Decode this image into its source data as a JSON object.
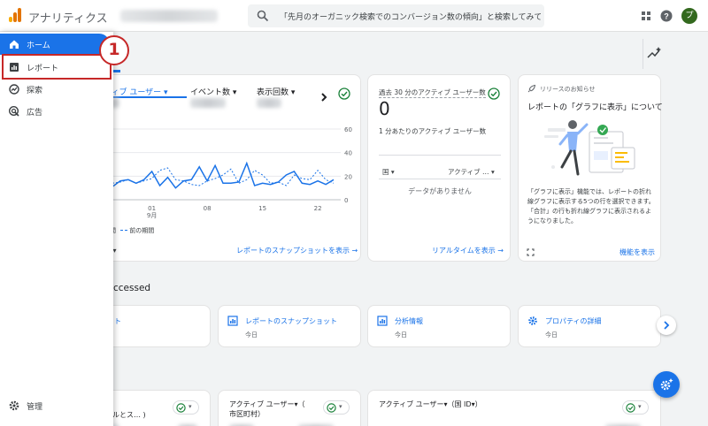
{
  "header": {
    "app_title": "アナリティクス",
    "search_placeholder": "「先月のオーガニック検索でのコンバージョン数の傾向」と検索してみてく…",
    "avatar_initial": "プ"
  },
  "sidebar": {
    "items": [
      {
        "label": "ホーム",
        "icon": "home-icon",
        "active": true
      },
      {
        "label": "レポート",
        "icon": "bar-chart-icon",
        "active": false
      },
      {
        "label": "探索",
        "icon": "explore-icon",
        "active": false
      },
      {
        "label": "広告",
        "icon": "ads-icon",
        "active": false
      }
    ],
    "admin_label": "管理"
  },
  "annotation": {
    "callout_number": "1",
    "color": "#c62828"
  },
  "overview_card": {
    "tabs": [
      {
        "label": "ティブ ユーザー ▾",
        "active": true
      },
      {
        "label": "イベント数 ▾",
        "active": false
      },
      {
        "label": "表示回数 ▾",
        "active": false
      }
    ],
    "legend_current": "日間",
    "legend_previous": "前の期間",
    "period_selector": "間 ▾",
    "link": "レポートのスナップショットを表示 →"
  },
  "chart_data": {
    "type": "line",
    "title": "",
    "y_ticks": [
      "60",
      "40",
      "20",
      "0"
    ],
    "ylim": [
      0,
      60
    ],
    "x_tick_labels": [
      "01\n9月",
      "08",
      "15",
      "22"
    ],
    "x_tick_days": [
      5,
      12,
      19,
      26
    ],
    "grid": true,
    "series": [
      {
        "name": "日間",
        "style": "solid",
        "color": "#1a73e8",
        "values": [
          11,
          16,
          17,
          14,
          17,
          24,
          12,
          19,
          10,
          16,
          17,
          28,
          16,
          29,
          14,
          14,
          15,
          31,
          12,
          14,
          13,
          15,
          21,
          24,
          14,
          13,
          16,
          13,
          17
        ]
      },
      {
        "name": "前の期間",
        "style": "dashed",
        "color": "#1a73e8",
        "values": [
          14,
          15,
          17,
          14,
          16,
          18,
          25,
          27,
          17,
          16,
          13,
          12,
          16,
          18,
          21,
          26,
          14,
          17,
          25,
          21,
          14,
          15,
          12,
          21,
          18,
          17,
          25,
          17,
          14
        ]
      }
    ]
  },
  "realtime_card": {
    "title": "過去 30 分のアクティブ ユーザー数",
    "value": "0",
    "subtitle": "1 分あたりのアクティブ ユーザー数",
    "col_country": "国 ▾",
    "col_active": "アクティブ … ▾",
    "empty": "データがありません",
    "link": "リアルタイムを表示 →"
  },
  "release_card": {
    "header": "リリースのお知らせ",
    "title": "レポートの「グラフに表示」について",
    "body": "「グラフに表示」機能では、レポートの折れ線グラフに表示する5つの行を選択できます。「合計」の行も折れ線グラフに表示されるようになりました。",
    "link": "機能を表示"
  },
  "recent": {
    "section_title": "ccessed",
    "cards": [
      {
        "label": "ト",
        "date": "",
        "icon": ""
      },
      {
        "label": "レポートのスナップショット",
        "date": "今日",
        "icon": "bar-chart-icon"
      },
      {
        "label": "分析情報",
        "date": "今日",
        "icon": "bar-chart-icon"
      },
      {
        "label": "プロパティの詳細",
        "date": "今日",
        "icon": "gear-icon"
      }
    ]
  },
  "bottom_cards": [
    {
      "title": "トルとス… )"
    },
    {
      "title": "アクティブ ユーザー▾（\n市区町村）"
    },
    {
      "title": "アクティブ ユーザー▾（国 ID▾）"
    }
  ]
}
